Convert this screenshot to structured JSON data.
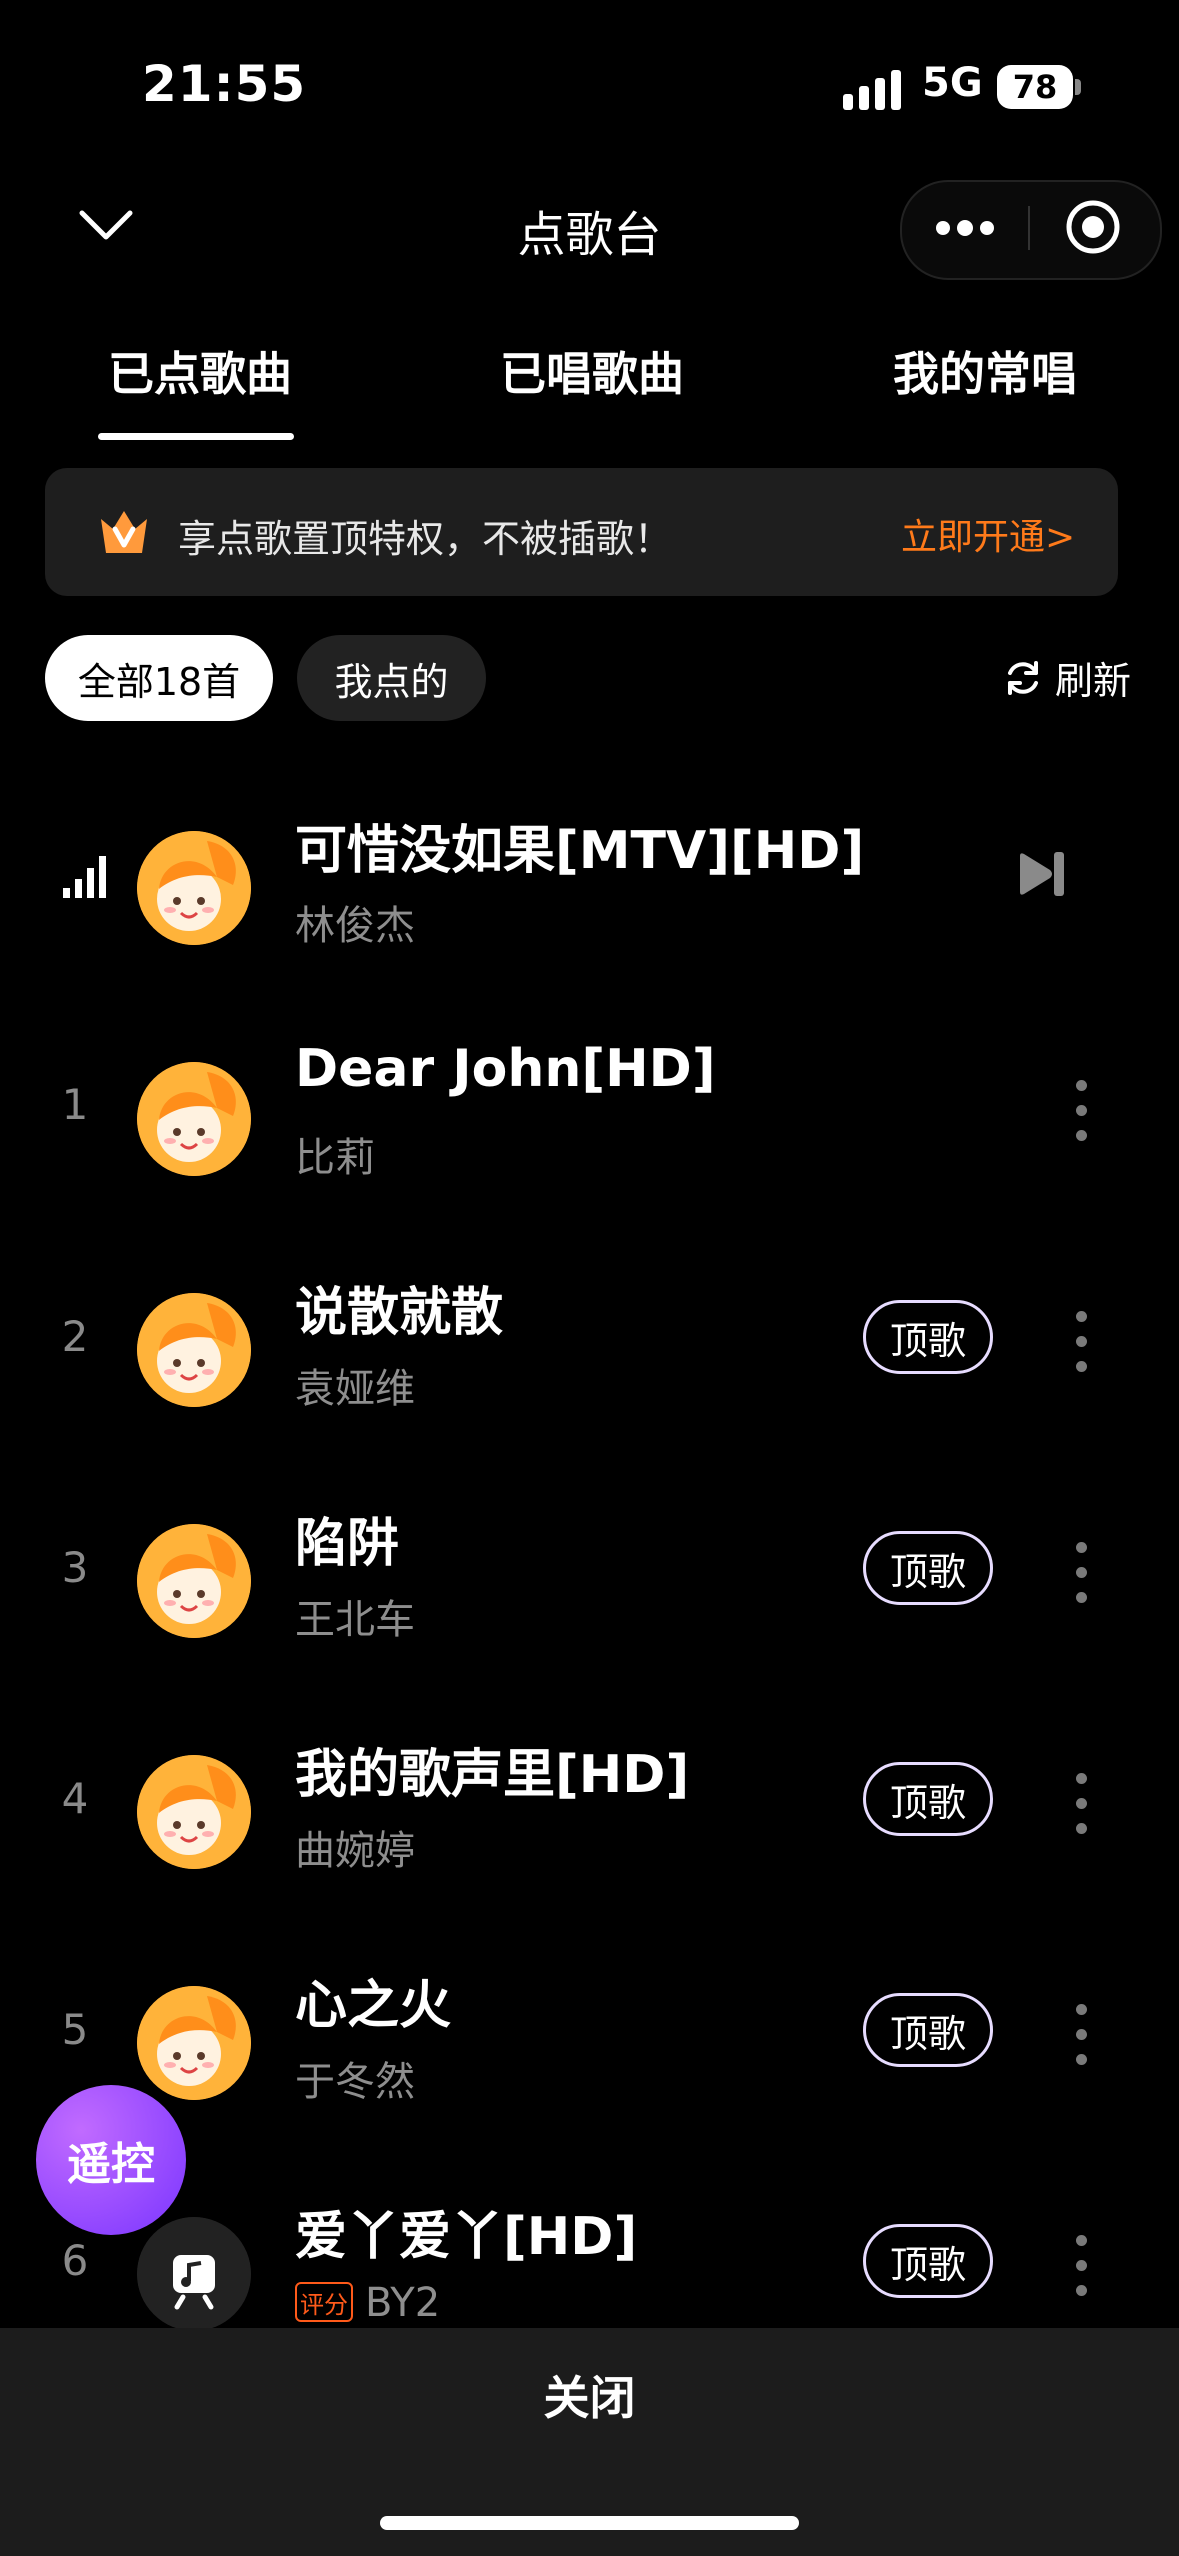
{
  "status_bar": {
    "time": "21:55",
    "network": "5G",
    "battery": "78"
  },
  "nav": {
    "title": "点歌台"
  },
  "tabs": [
    {
      "label": "已点歌曲",
      "active": true
    },
    {
      "label": "已唱歌曲",
      "active": false
    },
    {
      "label": "我的常唱",
      "active": false
    }
  ],
  "banner": {
    "text": "享点歌置顶特权，不被插歌！",
    "action": "立即开通>"
  },
  "filters": {
    "all": "全部18首",
    "mine": "我点的",
    "refresh": "刷新"
  },
  "now_playing": {
    "title": "可惜没如果[MTV][HD]",
    "artist": "林俊杰"
  },
  "queue": [
    {
      "index": "1",
      "title": "Dear John[HD]",
      "artist": "比莉",
      "top_button": ""
    },
    {
      "index": "2",
      "title": "说散就散",
      "artist": "袁娅维",
      "top_button": "顶歌"
    },
    {
      "index": "3",
      "title": "陷阱",
      "artist": "王北车",
      "top_button": "顶歌"
    },
    {
      "index": "4",
      "title": "我的歌声里[HD]",
      "artist": "曲婉婷",
      "top_button": "顶歌"
    },
    {
      "index": "5",
      "title": "心之火",
      "artist": "于冬然",
      "top_button": "顶歌"
    },
    {
      "index": "6",
      "title": "爱丫爱丫[HD]",
      "artist": "BY2",
      "top_button": "顶歌",
      "tag": "评分"
    }
  ],
  "fab": {
    "label": "遥控"
  },
  "footer": {
    "close": "关闭"
  },
  "colors": {
    "accent_orange": "#ff7a1a",
    "fab_purple": "#8f44ff",
    "avatar_orange": "#ffb33a"
  },
  "icons": [
    "chevron-down-icon",
    "more-dots-icon",
    "target-icon",
    "crown-icon",
    "refresh-icon",
    "playing-bars-icon",
    "skip-next-icon",
    "kebab-icon",
    "music-note-icon"
  ]
}
